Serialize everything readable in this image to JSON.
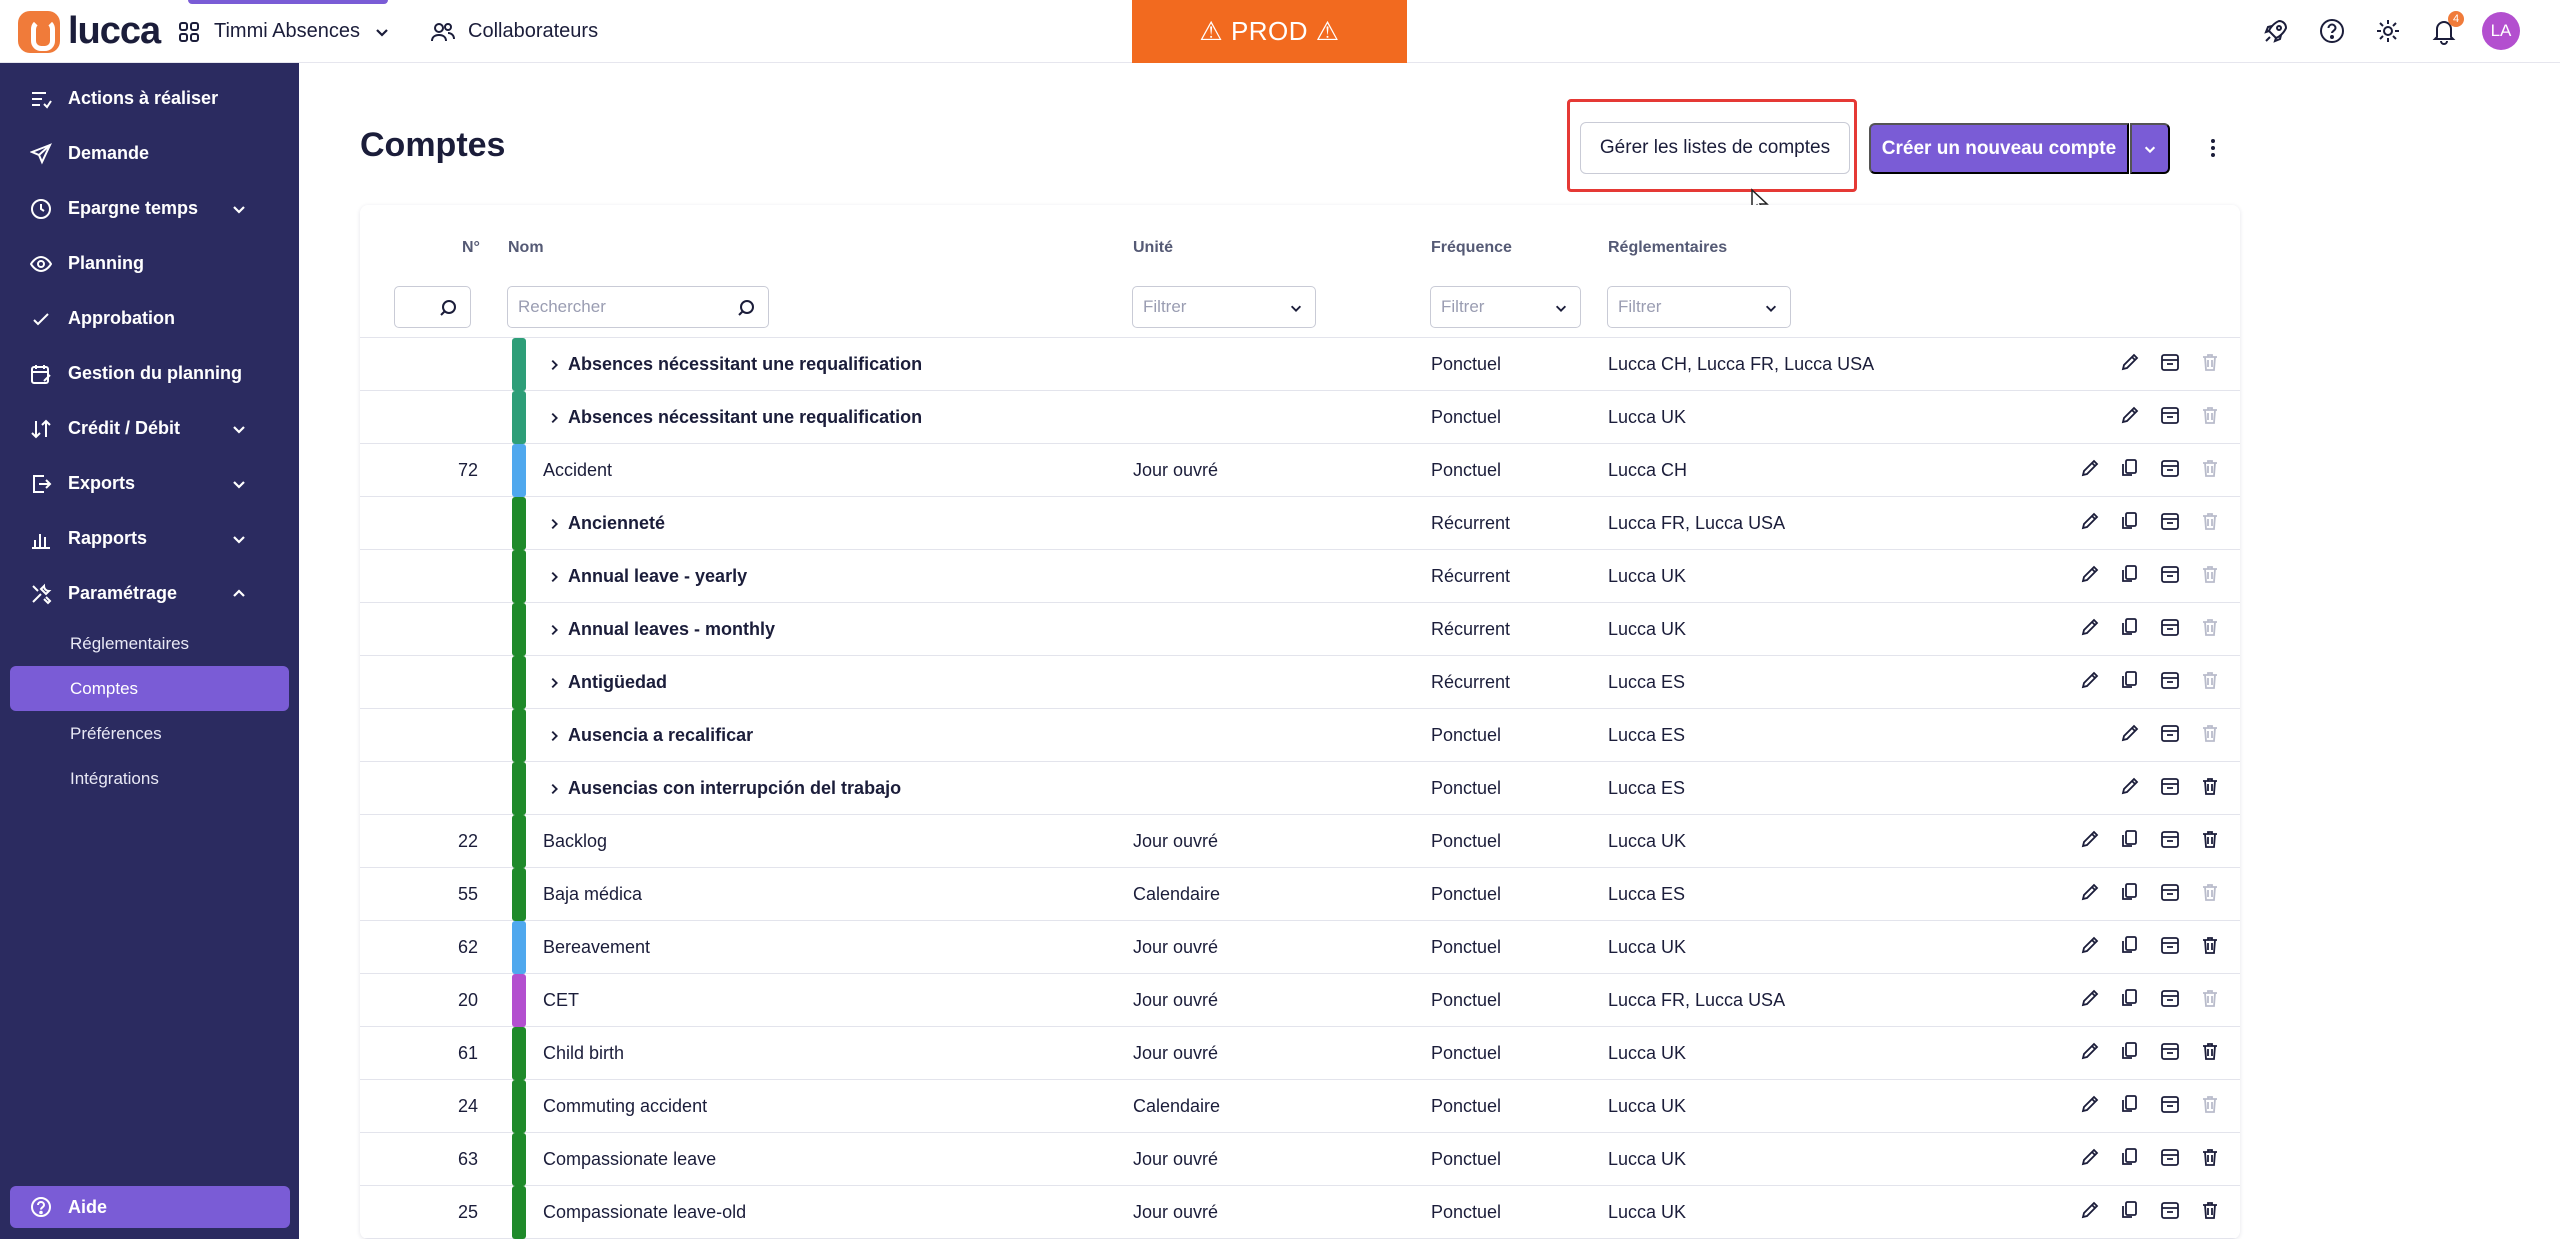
{
  "topbar": {
    "logo_text": "lucca",
    "app_name": "Timmi Absences",
    "collab_label": "Collaborateurs",
    "prod_banner": "⚠ PROD ⚠",
    "notif_count": "4",
    "avatar_initials": "LA"
  },
  "sidebar": {
    "items": [
      {
        "label": "Actions à réaliser",
        "icon": "list-check-icon"
      },
      {
        "label": "Demande",
        "icon": "send-icon"
      },
      {
        "label": "Epargne temps",
        "icon": "clock-icon"
      },
      {
        "label": "Planning",
        "icon": "eye-icon"
      },
      {
        "label": "Approbation",
        "icon": "check-icon"
      },
      {
        "label": "Gestion du planning",
        "icon": "calendar-edit-icon"
      },
      {
        "label": "Crédit / Débit",
        "icon": "sort-arrows-icon"
      },
      {
        "label": "Exports",
        "icon": "export-icon"
      },
      {
        "label": "Rapports",
        "icon": "chart-icon"
      },
      {
        "label": "Paramétrage",
        "icon": "tools-icon"
      }
    ],
    "sub_items": [
      {
        "label": "Réglementaires"
      },
      {
        "label": "Comptes"
      },
      {
        "label": "Préférences"
      },
      {
        "label": "Intégrations"
      }
    ],
    "help_label": "Aide"
  },
  "main": {
    "title": "Comptes",
    "manage_lists_label": "Gérer les listes de comptes",
    "create_label": "Créer un nouveau compte"
  },
  "table": {
    "headers": {
      "num": "N°",
      "name": "Nom",
      "unit": "Unité",
      "freq": "Fréquence",
      "reg": "Réglementaires"
    },
    "search_placeholder": "Rechercher",
    "filter_placeholder": "Filtrer",
    "rows": [
      {
        "num": "",
        "name": "Absences nécessitant une requalification",
        "group": true,
        "color": "#2e9e78",
        "unit": "",
        "freq": "Ponctuel",
        "reg": "Lucca CH, Lucca FR, Lucca USA",
        "copy": false,
        "del": false
      },
      {
        "num": "",
        "name": "Absences nécessitant une requalification",
        "group": true,
        "color": "#2e9e78",
        "unit": "",
        "freq": "Ponctuel",
        "reg": "Lucca UK",
        "copy": false,
        "del": false
      },
      {
        "num": "72",
        "name": "Accident",
        "group": false,
        "color": "#4fa8ee",
        "unit": "Jour ouvré",
        "freq": "Ponctuel",
        "reg": "Lucca CH",
        "copy": true,
        "del": false
      },
      {
        "num": "",
        "name": "Ancienneté",
        "group": true,
        "color": "#1f8a2a",
        "unit": "",
        "freq": "Récurrent",
        "reg": "Lucca FR, Lucca USA",
        "copy": true,
        "del": false
      },
      {
        "num": "",
        "name": "Annual leave - yearly",
        "group": true,
        "color": "#1f8a2a",
        "unit": "",
        "freq": "Récurrent",
        "reg": "Lucca UK",
        "copy": true,
        "del": false
      },
      {
        "num": "",
        "name": "Annual leaves - monthly",
        "group": true,
        "color": "#1f8a2a",
        "unit": "",
        "freq": "Récurrent",
        "reg": "Lucca UK",
        "copy": true,
        "del": false
      },
      {
        "num": "",
        "name": "Antigüedad",
        "group": true,
        "color": "#1f8a2a",
        "unit": "",
        "freq": "Récurrent",
        "reg": "Lucca ES",
        "copy": true,
        "del": false
      },
      {
        "num": "",
        "name": "Ausencia a recalificar",
        "group": true,
        "color": "#1f8a2a",
        "unit": "",
        "freq": "Ponctuel",
        "reg": "Lucca ES",
        "copy": false,
        "del": false
      },
      {
        "num": "",
        "name": "Ausencias con interrupción del trabajo",
        "group": true,
        "color": "#1f8a2a",
        "unit": "",
        "freq": "Ponctuel",
        "reg": "Lucca ES",
        "copy": false,
        "del": true
      },
      {
        "num": "22",
        "name": "Backlog",
        "group": false,
        "color": "#1f8a2a",
        "unit": "Jour ouvré",
        "freq": "Ponctuel",
        "reg": "Lucca UK",
        "copy": true,
        "del": true
      },
      {
        "num": "55",
        "name": "Baja médica",
        "group": false,
        "color": "#1f8a2a",
        "unit": "Calendaire",
        "freq": "Ponctuel",
        "reg": "Lucca ES",
        "copy": true,
        "del": false
      },
      {
        "num": "62",
        "name": "Bereavement",
        "group": false,
        "color": "#4fa8ee",
        "unit": "Jour ouvré",
        "freq": "Ponctuel",
        "reg": "Lucca UK",
        "copy": true,
        "del": true
      },
      {
        "num": "20",
        "name": "CET",
        "group": false,
        "color": "#b34fcf",
        "unit": "Jour ouvré",
        "freq": "Ponctuel",
        "reg": "Lucca FR, Lucca USA",
        "copy": true,
        "del": false
      },
      {
        "num": "61",
        "name": "Child birth",
        "group": false,
        "color": "#1f8a2a",
        "unit": "Jour ouvré",
        "freq": "Ponctuel",
        "reg": "Lucca UK",
        "copy": true,
        "del": true
      },
      {
        "num": "24",
        "name": "Commuting accident",
        "group": false,
        "color": "#1f8a2a",
        "unit": "Calendaire",
        "freq": "Ponctuel",
        "reg": "Lucca UK",
        "copy": true,
        "del": false
      },
      {
        "num": "63",
        "name": "Compassionate leave",
        "group": false,
        "color": "#1f8a2a",
        "unit": "Jour ouvré",
        "freq": "Ponctuel",
        "reg": "Lucca UK",
        "copy": true,
        "del": true
      },
      {
        "num": "25",
        "name": "Compassionate leave-old",
        "group": false,
        "color": "#1f8a2a",
        "unit": "Jour ouvré",
        "freq": "Ponctuel",
        "reg": "Lucca UK",
        "copy": true,
        "del": true
      }
    ]
  }
}
